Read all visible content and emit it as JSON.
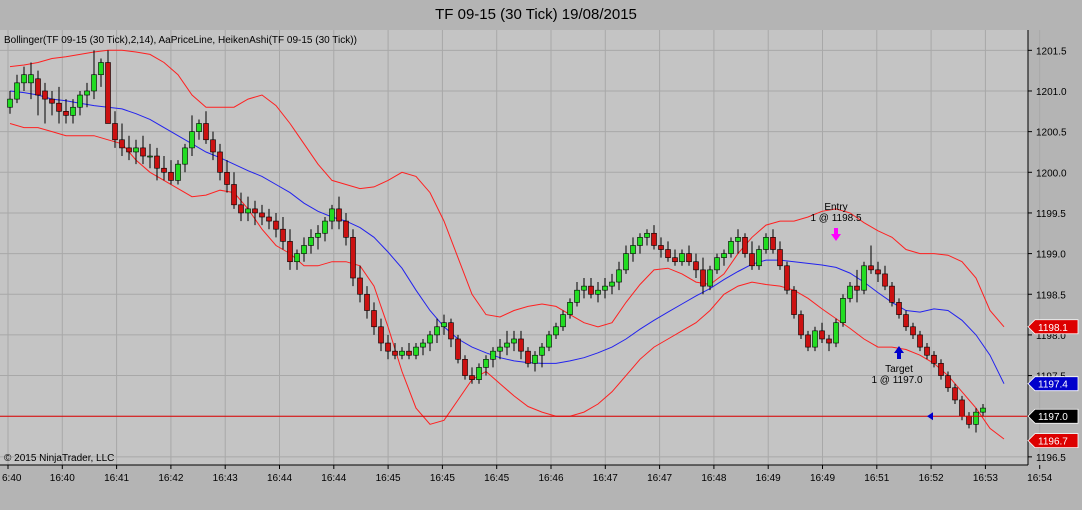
{
  "chart_data": {
    "type": "candlestick",
    "title": "TF 09-15 (30 Tick)  19/08/2015",
    "indicator_label": "Bollinger(TF 09-15 (30 Tick),2,14), AaPriceLine, HeikenAshi(TF 09-15 (30 Tick))",
    "copyright": "© 2015 NinjaTrader, LLC",
    "ylim": [
      1196.4,
      1201.75
    ],
    "y_ticks": [
      "1196.5",
      "1197.0",
      "1197.5",
      "1198.0",
      "1198.5",
      "1199.0",
      "1199.5",
      "1200.0",
      "1200.5",
      "1201.0",
      "1201.5"
    ],
    "x_ticks": [
      "6:40",
      "16:40",
      "16:41",
      "16:42",
      "16:43",
      "16:44",
      "16:44",
      "16:45",
      "16:45",
      "16:45",
      "16:46",
      "16:47",
      "16:47",
      "16:48",
      "16:49",
      "16:49",
      "16:51",
      "16:52",
      "16:53",
      "16:54"
    ],
    "colors": {
      "up": "#22dd22",
      "down": "#cc1111",
      "band": "#ff2020",
      "middle": "#2222ee",
      "price_line": "#dd0000",
      "entry": "#ff00ff",
      "target": "#0000cc"
    },
    "candles": [
      [
        1200.8,
        1201.0,
        1200.72,
        1200.9
      ],
      [
        1200.9,
        1201.2,
        1200.85,
        1201.1
      ],
      [
        1201.1,
        1201.3,
        1201.0,
        1201.2
      ],
      [
        1201.1,
        1201.35,
        1200.9,
        1201.2
      ],
      [
        1201.15,
        1201.25,
        1200.7,
        1200.95
      ],
      [
        1201.0,
        1201.1,
        1200.6,
        1200.9
      ],
      [
        1200.9,
        1201.0,
        1200.7,
        1200.85
      ],
      [
        1200.85,
        1201.05,
        1200.6,
        1200.75
      ],
      [
        1200.75,
        1200.9,
        1200.6,
        1200.7
      ],
      [
        1200.7,
        1200.9,
        1200.6,
        1200.8
      ],
      [
        1200.8,
        1201.0,
        1200.7,
        1200.95
      ],
      [
        1200.95,
        1201.1,
        1200.8,
        1201.0
      ],
      [
        1201.0,
        1201.5,
        1200.9,
        1201.2
      ],
      [
        1201.2,
        1201.4,
        1201.05,
        1201.35
      ],
      [
        1201.35,
        1201.5,
        1200.6,
        1200.6
      ],
      [
        1200.6,
        1200.75,
        1200.3,
        1200.4
      ],
      [
        1200.4,
        1200.6,
        1200.2,
        1200.3
      ],
      [
        1200.3,
        1200.45,
        1200.15,
        1200.25
      ],
      [
        1200.25,
        1200.4,
        1200.1,
        1200.3
      ],
      [
        1200.3,
        1200.45,
        1200.1,
        1200.2
      ],
      [
        1200.2,
        1200.35,
        1200.05,
        1200.2
      ],
      [
        1200.2,
        1200.3,
        1199.9,
        1200.05
      ],
      [
        1200.05,
        1200.2,
        1199.9,
        1200.0
      ],
      [
        1200.0,
        1200.15,
        1199.85,
        1199.9
      ],
      [
        1199.9,
        1200.15,
        1199.85,
        1200.1
      ],
      [
        1200.1,
        1200.35,
        1200.0,
        1200.3
      ],
      [
        1200.3,
        1200.7,
        1200.2,
        1200.5
      ],
      [
        1200.5,
        1200.65,
        1200.4,
        1200.6
      ],
      [
        1200.6,
        1200.75,
        1200.35,
        1200.4
      ],
      [
        1200.4,
        1200.5,
        1200.15,
        1200.25
      ],
      [
        1200.25,
        1200.35,
        1199.9,
        1200.0
      ],
      [
        1200.0,
        1200.15,
        1199.75,
        1199.85
      ],
      [
        1199.85,
        1200.0,
        1199.55,
        1199.6
      ],
      [
        1199.6,
        1199.75,
        1199.4,
        1199.5
      ],
      [
        1199.5,
        1199.7,
        1199.4,
        1199.55
      ],
      [
        1199.55,
        1199.65,
        1199.35,
        1199.5
      ],
      [
        1199.5,
        1199.6,
        1199.35,
        1199.45
      ],
      [
        1199.45,
        1199.55,
        1199.3,
        1199.4
      ],
      [
        1199.4,
        1199.5,
        1199.2,
        1199.3
      ],
      [
        1199.3,
        1199.45,
        1199.05,
        1199.15
      ],
      [
        1199.15,
        1199.3,
        1198.8,
        1198.9
      ],
      [
        1198.9,
        1199.05,
        1198.8,
        1199.0
      ],
      [
        1199.0,
        1199.2,
        1198.9,
        1199.1
      ],
      [
        1199.1,
        1199.3,
        1199.0,
        1199.2
      ],
      [
        1199.2,
        1199.35,
        1199.05,
        1199.25
      ],
      [
        1199.25,
        1199.45,
        1199.15,
        1199.4
      ],
      [
        1199.4,
        1199.6,
        1199.3,
        1199.55
      ],
      [
        1199.55,
        1199.7,
        1199.3,
        1199.4
      ],
      [
        1199.4,
        1199.5,
        1199.1,
        1199.2
      ],
      [
        1199.2,
        1199.3,
        1198.6,
        1198.7
      ],
      [
        1198.7,
        1198.85,
        1198.4,
        1198.5
      ],
      [
        1198.5,
        1198.6,
        1198.2,
        1198.3
      ],
      [
        1198.3,
        1198.4,
        1198.0,
        1198.1
      ],
      [
        1198.1,
        1198.2,
        1197.8,
        1197.9
      ],
      [
        1197.9,
        1198.0,
        1197.7,
        1197.8
      ],
      [
        1197.8,
        1197.9,
        1197.7,
        1197.75
      ],
      [
        1197.75,
        1197.85,
        1197.7,
        1197.8
      ],
      [
        1197.8,
        1197.9,
        1197.7,
        1197.75
      ],
      [
        1197.75,
        1197.9,
        1197.7,
        1197.85
      ],
      [
        1197.85,
        1197.95,
        1197.75,
        1197.9
      ],
      [
        1197.9,
        1198.05,
        1197.8,
        1198.0
      ],
      [
        1198.0,
        1198.2,
        1197.9,
        1198.1
      ],
      [
        1198.1,
        1198.25,
        1198.0,
        1198.15
      ],
      [
        1198.15,
        1198.2,
        1197.85,
        1197.95
      ],
      [
        1197.95,
        1198.0,
        1197.65,
        1197.7
      ],
      [
        1197.7,
        1197.75,
        1197.45,
        1197.5
      ],
      [
        1197.5,
        1197.6,
        1197.4,
        1197.45
      ],
      [
        1197.45,
        1197.65,
        1197.4,
        1197.6
      ],
      [
        1197.6,
        1197.75,
        1197.5,
        1197.7
      ],
      [
        1197.7,
        1197.85,
        1197.6,
        1197.8
      ],
      [
        1197.8,
        1197.95,
        1197.7,
        1197.85
      ],
      [
        1197.85,
        1198.05,
        1197.75,
        1197.9
      ],
      [
        1197.9,
        1198.05,
        1197.8,
        1197.95
      ],
      [
        1197.95,
        1198.05,
        1197.7,
        1197.8
      ],
      [
        1197.8,
        1197.85,
        1197.6,
        1197.65
      ],
      [
        1197.65,
        1197.8,
        1197.55,
        1197.75
      ],
      [
        1197.75,
        1197.9,
        1197.6,
        1197.85
      ],
      [
        1197.85,
        1198.05,
        1197.8,
        1198.0
      ],
      [
        1198.0,
        1198.15,
        1197.95,
        1198.1
      ],
      [
        1198.1,
        1198.3,
        1198.05,
        1198.25
      ],
      [
        1198.25,
        1198.45,
        1198.2,
        1198.4
      ],
      [
        1198.4,
        1198.65,
        1198.35,
        1198.55
      ],
      [
        1198.55,
        1198.7,
        1198.45,
        1198.6
      ],
      [
        1198.6,
        1198.7,
        1198.45,
        1198.5
      ],
      [
        1198.5,
        1198.65,
        1198.4,
        1198.55
      ],
      [
        1198.55,
        1198.7,
        1198.45,
        1198.6
      ],
      [
        1198.6,
        1198.75,
        1198.5,
        1198.65
      ],
      [
        1198.65,
        1198.9,
        1198.55,
        1198.8
      ],
      [
        1198.8,
        1199.1,
        1198.75,
        1199.0
      ],
      [
        1199.0,
        1199.2,
        1198.9,
        1199.1
      ],
      [
        1199.1,
        1199.25,
        1199.0,
        1199.2
      ],
      [
        1199.2,
        1199.3,
        1199.1,
        1199.25
      ],
      [
        1199.25,
        1199.35,
        1199.05,
        1199.1
      ],
      [
        1199.1,
        1199.2,
        1198.95,
        1199.05
      ],
      [
        1199.05,
        1199.15,
        1198.9,
        1198.95
      ],
      [
        1198.95,
        1199.05,
        1198.85,
        1198.9
      ],
      [
        1198.9,
        1199.05,
        1198.85,
        1199.0
      ],
      [
        1199.0,
        1199.1,
        1198.85,
        1198.9
      ],
      [
        1198.9,
        1199.0,
        1198.7,
        1198.8
      ],
      [
        1198.8,
        1198.95,
        1198.5,
        1198.6
      ],
      [
        1198.6,
        1198.85,
        1198.55,
        1198.8
      ],
      [
        1198.8,
        1199.0,
        1198.75,
        1198.95
      ],
      [
        1198.95,
        1199.05,
        1198.85,
        1199.0
      ],
      [
        1199.0,
        1199.2,
        1198.95,
        1199.15
      ],
      [
        1199.15,
        1199.3,
        1199.0,
        1199.2
      ],
      [
        1199.2,
        1199.25,
        1198.95,
        1199.0
      ],
      [
        1199.0,
        1199.15,
        1198.8,
        1198.85
      ],
      [
        1198.85,
        1199.1,
        1198.8,
        1199.05
      ],
      [
        1199.05,
        1199.25,
        1199.0,
        1199.2
      ],
      [
        1199.2,
        1199.3,
        1199.0,
        1199.05
      ],
      [
        1199.05,
        1199.15,
        1198.8,
        1198.85
      ],
      [
        1198.85,
        1198.9,
        1198.5,
        1198.55
      ],
      [
        1198.55,
        1198.6,
        1198.2,
        1198.25
      ],
      [
        1198.25,
        1198.3,
        1197.95,
        1198.0
      ],
      [
        1198.0,
        1198.05,
        1197.8,
        1197.85
      ],
      [
        1197.85,
        1198.1,
        1197.8,
        1198.05
      ],
      [
        1198.05,
        1198.15,
        1197.9,
        1197.95
      ],
      [
        1197.95,
        1198.0,
        1197.8,
        1197.9
      ],
      [
        1197.9,
        1198.2,
        1197.85,
        1198.15
      ],
      [
        1198.15,
        1198.5,
        1198.1,
        1198.45
      ],
      [
        1198.45,
        1198.65,
        1198.4,
        1198.6
      ],
      [
        1198.6,
        1198.8,
        1198.4,
        1198.55
      ],
      [
        1198.55,
        1198.9,
        1198.5,
        1198.85
      ],
      [
        1198.85,
        1199.1,
        1198.75,
        1198.8
      ],
      [
        1198.8,
        1198.9,
        1198.65,
        1198.75
      ],
      [
        1198.75,
        1198.85,
        1198.55,
        1198.6
      ],
      [
        1198.6,
        1198.65,
        1198.35,
        1198.4
      ],
      [
        1198.4,
        1198.45,
        1198.2,
        1198.25
      ],
      [
        1198.25,
        1198.3,
        1198.05,
        1198.1
      ],
      [
        1198.1,
        1198.15,
        1197.95,
        1198.0
      ],
      [
        1198.0,
        1198.05,
        1197.8,
        1197.85
      ],
      [
        1197.85,
        1197.9,
        1197.7,
        1197.75
      ],
      [
        1197.75,
        1197.8,
        1197.6,
        1197.65
      ],
      [
        1197.65,
        1197.7,
        1197.45,
        1197.5
      ],
      [
        1197.5,
        1197.55,
        1197.3,
        1197.35
      ],
      [
        1197.35,
        1197.4,
        1197.15,
        1197.2
      ],
      [
        1197.2,
        1197.25,
        1196.95,
        1197.0
      ],
      [
        1197.0,
        1197.05,
        1196.85,
        1196.9
      ],
      [
        1196.9,
        1197.1,
        1196.8,
        1197.05
      ],
      [
        1197.05,
        1197.15,
        1197.0,
        1197.1
      ]
    ],
    "upper_band": [
      1201.3,
      1201.32,
      1201.35,
      1201.4,
      1201.42,
      1201.45,
      1201.48,
      1201.5,
      1201.5,
      1201.48,
      1201.45,
      1201.35,
      1201.2,
      1200.95,
      1200.8,
      1200.8,
      1200.8,
      1200.9,
      1200.95,
      1200.82,
      1200.6,
      1200.35,
      1200.1,
      1199.9,
      1199.85,
      1199.8,
      1199.82,
      1199.9,
      1200.0,
      1199.95,
      1199.75,
      1199.4,
      1198.95,
      1198.5,
      1198.25,
      1198.22,
      1198.3,
      1198.35,
      1198.38,
      1198.35,
      1198.25,
      1198.15,
      1198.1,
      1198.15,
      1198.4,
      1198.62,
      1198.8,
      1198.82,
      1198.75,
      1198.65,
      1198.62,
      1198.75,
      1199.0,
      1199.2,
      1199.35,
      1199.4,
      1199.4,
      1199.45,
      1199.52,
      1199.55,
      1199.5,
      1199.38,
      1199.28,
      1199.2,
      1199.05,
      1199.0,
      1199.0,
      1198.98,
      1198.9,
      1198.7,
      1198.3,
      1198.1
    ],
    "lower_band": [
      1200.6,
      1200.55,
      1200.55,
      1200.5,
      1200.45,
      1200.45,
      1200.45,
      1200.4,
      1200.35,
      1200.15,
      1200.0,
      1199.9,
      1199.8,
      1199.7,
      1199.72,
      1199.78,
      1199.75,
      1199.55,
      1199.3,
      1199.1,
      1199.0,
      1198.85,
      1198.85,
      1198.9,
      1198.9,
      1198.85,
      1198.6,
      1198.1,
      1197.55,
      1197.1,
      1196.9,
      1196.95,
      1197.2,
      1197.45,
      1197.55,
      1197.4,
      1197.25,
      1197.12,
      1197.05,
      1197.0,
      1197.0,
      1197.05,
      1197.15,
      1197.3,
      1197.5,
      1197.7,
      1197.85,
      1197.95,
      1198.05,
      1198.15,
      1198.3,
      1198.5,
      1198.6,
      1198.65,
      1198.62,
      1198.6,
      1198.55,
      1198.45,
      1198.32,
      1198.2,
      1198.08,
      1197.95,
      1197.85,
      1197.85,
      1197.82,
      1197.75,
      1197.65,
      1197.5,
      1197.3,
      1197.1,
      1196.85,
      1196.72
    ],
    "middle_band": [
      1201.0,
      1200.98,
      1200.95,
      1200.9,
      1200.88,
      1200.85,
      1200.82,
      1200.8,
      1200.78,
      1200.72,
      1200.65,
      1200.55,
      1200.45,
      1200.35,
      1200.25,
      1200.18,
      1200.1,
      1200.02,
      1199.95,
      1199.85,
      1199.75,
      1199.62,
      1199.52,
      1199.45,
      1199.4,
      1199.32,
      1199.2,
      1199.02,
      1198.82,
      1198.55,
      1198.3,
      1198.1,
      1197.95,
      1197.85,
      1197.78,
      1197.72,
      1197.68,
      1197.66,
      1197.65,
      1197.65,
      1197.68,
      1197.72,
      1197.78,
      1197.85,
      1197.95,
      1198.07,
      1198.18,
      1198.28,
      1198.38,
      1198.48,
      1198.57,
      1198.68,
      1198.78,
      1198.87,
      1198.92,
      1198.92,
      1198.9,
      1198.88,
      1198.86,
      1198.83,
      1198.76,
      1198.65,
      1198.52,
      1198.4,
      1198.3,
      1198.28,
      1198.32,
      1198.3,
      1198.18,
      1198.0,
      1197.75,
      1197.4
    ],
    "price_line": {
      "value": 1197.0,
      "label": "1197.0"
    },
    "axis_badges": [
      {
        "label": "1198.1",
        "value": 1198.1,
        "color": "#dd0000"
      },
      {
        "label": "1197.4",
        "value": 1197.4,
        "color": "#0000cc"
      },
      {
        "label": "1197.0",
        "value": 1197.0,
        "color": "#000000"
      },
      {
        "label": "1196.7",
        "value": 1196.7,
        "color": "#dd0000"
      }
    ],
    "annotations": {
      "entry": {
        "line1": "Entry",
        "line2": "1 @ 1198.5",
        "candle": 118
      },
      "target": {
        "line1": "Target",
        "line2": "1 @ 1197.0",
        "candle": 127
      }
    }
  }
}
